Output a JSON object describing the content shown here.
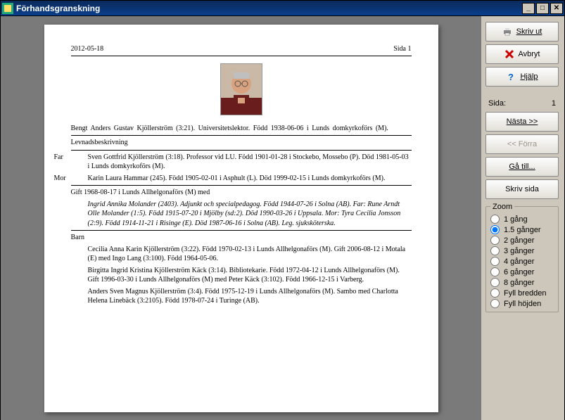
{
  "window": {
    "title": "Förhandsgranskning"
  },
  "toolbar": {
    "print": "Skriv ut",
    "cancel": "Avbryt",
    "help": "Hjälp",
    "page_label": "Sida:",
    "page_value": "1",
    "next": "Nästa >>",
    "prev": "<< Förra",
    "goto": "Gå till...",
    "printpage": "Skriv sida"
  },
  "zoom": {
    "legend": "Zoom",
    "options": [
      "1 gång",
      "1.5 gånger",
      "2 gånger",
      "3 gånger",
      "4 gånger",
      "6 gånger",
      "8 gånger",
      "Fyll bredden",
      "Fyll höjden"
    ],
    "selected": 1
  },
  "page": {
    "date": "2012-05-18",
    "pagelabel": "Sida 1",
    "headline": "Bengt  Anders  Gustav  Kjöllerström   (3:21).   Universitetslektor.    Född   1938-06-06    i Lunds  domkyrkoförs   (M).",
    "bio_label": "Levnadsbeskrivning",
    "father": "Sven  Gottfrid  Kjöllerström   (3:18).  Professor  vid  LU.  Född  1901-01-28   i Stockebo,  Mossebo   (P). Död  1981-05-03   i Lunds  domkyrkoförs   (M).",
    "mother": "Karin  Laura  Hammar   (245).  Född  1905-02-01   i Asphult   (L).  Död  1999-02-15   i Lunds domkyrkoförs   (M).",
    "married": "Gift  1968-08-17   i Lunds  Allhelgonaförs   (M)  med",
    "spouse": "Ingrid  Annika  Molander   (2403).  Adjunkt  och  specialpedagog.  Född  1944-07-26   i Solna  (AB).  Far: Rune Arndt Olle Molander (1:5). Född 1915-07-20 i Mjölby (sd:2). Död 1990-03-26 i Uppsala. Mor: Tyra Cecilia Jonsson (2:9). Född 1914-11-21 i Risinge (E). Död 1987-06-16 i Solna (AB). Leg. sjuksköterska.",
    "children_label": "Barn",
    "child1": "Cecilia  Anna  Karin  Kjöllerström   (3:22).  Född  1970-02-13   i Lunds  Allhelgonaförs   (M).  Gift 2006-08-12 i Motala (E) med Ingo Lang (3:100). Född 1964-05-06.",
    "child2": "Birgitta  Ingrid  Kristina  Kjöllerström   Käck   (3:14).  Bibliotekarie.  Född  1972-04-12   i Lunds Allhelgonaförs   (M).   Gift 1996-03-30 i Lunds Allhelgonaförs (M) med Peter Käck (3:102). Född 1966-12-15 i Varberg.",
    "child3": "Anders  Sven  Magnus  Kjöllerström   (3:4).  Född  1975-12-19   i Lunds  Allhelgonaförs   (M).  Sambo med Charlotta Helena Linebäck (3:2105). Född 1978-07-24 i Turinge (AB).",
    "far_label": "Far",
    "mor_label": "Mor"
  }
}
